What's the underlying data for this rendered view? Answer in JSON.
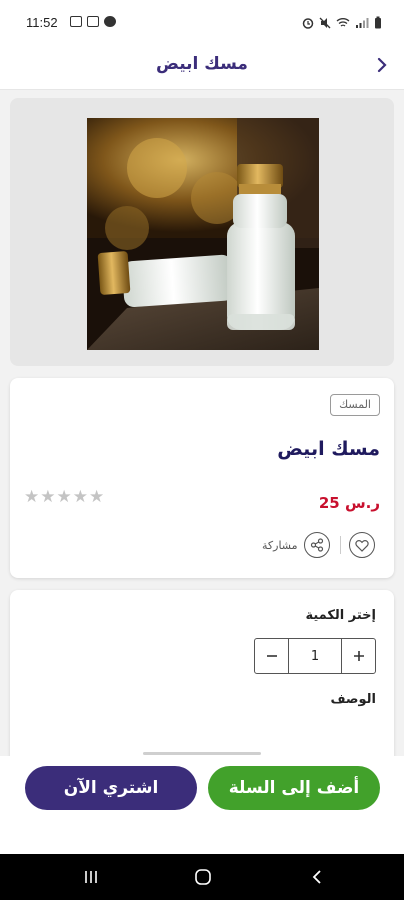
{
  "status_bar": {
    "time": "11:52",
    "icons_left": [
      "notification-icon",
      "image-icon",
      "app-icon"
    ],
    "icons_right": [
      "alarm-icon",
      "mute-icon",
      "wifi-icon",
      "signal-icon",
      "battery-icon"
    ]
  },
  "header": {
    "title": "مسك ابيض",
    "back_icon": "chevron-right-icon"
  },
  "product": {
    "image_alt": "white musk perfume bottles",
    "category_tag": "المسك",
    "name": "مسك ابيض",
    "rating": 0,
    "rating_max": 5,
    "price": "25 ر.س",
    "share_label": "مشاركة"
  },
  "quantity": {
    "label": "إختر الكمية",
    "value": "1",
    "minus_icon": "minus-icon",
    "plus_icon": "plus-icon"
  },
  "description": {
    "label": "الوصف"
  },
  "buttons": {
    "add_to_cart": "أضف إلى السلة",
    "buy_now": "اشتري الآن"
  },
  "colors": {
    "primary": "#3b2d7a",
    "accent_green": "#42a12b",
    "price_red": "#c8102e"
  }
}
